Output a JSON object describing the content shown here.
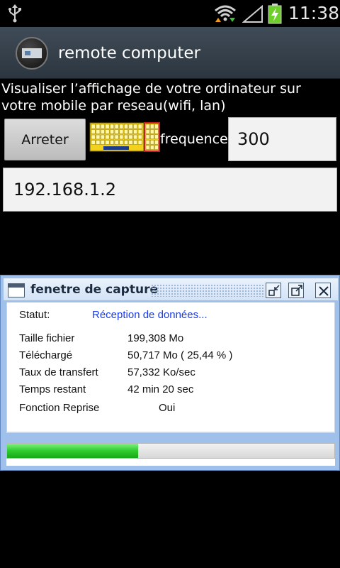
{
  "status_bar": {
    "time": "11:38",
    "icons": [
      "usb-icon",
      "wifi-icon",
      "signal-icon",
      "battery-charging-icon"
    ]
  },
  "action_bar": {
    "title": "remote computer",
    "icon": "remote-computer-app-icon"
  },
  "main": {
    "description": "Visualiser l’affichage de votre ordinateur sur votre mobile par reseau(wifi, lan)",
    "stop_button_label": "Arreter",
    "keyboard_icon": "keyboard-icon",
    "frequency_label": "frequence",
    "frequency_value": "300",
    "ip_value": "192.168.1.2"
  },
  "capture_window": {
    "title": "fenetre de capture",
    "rows": [
      {
        "label": "Statut:",
        "value": "Réception de données..."
      },
      {
        "label": "Taille fichier",
        "value": "199,308  Mo"
      },
      {
        "label": "Téléchargé",
        "value": "50,717  Mo  ( 25,44 % )"
      },
      {
        "label": "Taux de transfert",
        "value": "57,332  Ko/sec"
      },
      {
        "label": "Temps restant",
        "value": "42 min 20 sec"
      },
      {
        "label": "Fonction Reprise",
        "value": "Oui"
      }
    ],
    "progress_fraction": 0.2544,
    "colors": {
      "status_value": "#1b3cf0",
      "progress": "#2ecb2e"
    }
  }
}
